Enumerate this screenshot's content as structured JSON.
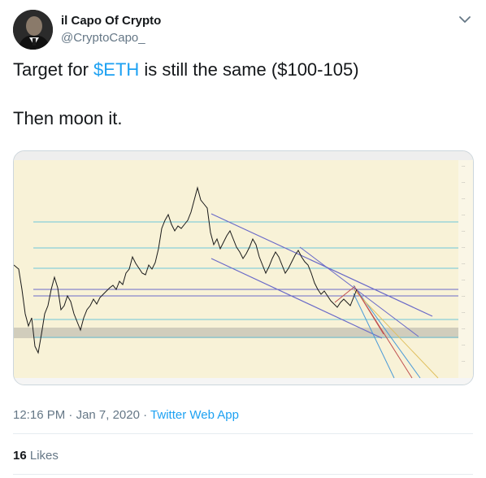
{
  "author": {
    "name": "il Capo Of Crypto",
    "handle": "@CryptoCapo_"
  },
  "tweet": {
    "line1_pre": "Target for ",
    "cashtag": "$ETH",
    "line1_post": " is still the same ($100-105)",
    "line2": "Then moon it."
  },
  "meta": {
    "time": "12:16 PM",
    "separator": " · ",
    "date": "Jan 7, 2020",
    "app": "Twitter Web App"
  },
  "stats": {
    "likes_count": "16",
    "likes_label": "Likes"
  },
  "colors": {
    "link": "#1da1f2",
    "secondary_text": "#657786",
    "chart_background": "#f8f2d7"
  },
  "icons": {
    "more": "chevron-down-icon"
  }
}
